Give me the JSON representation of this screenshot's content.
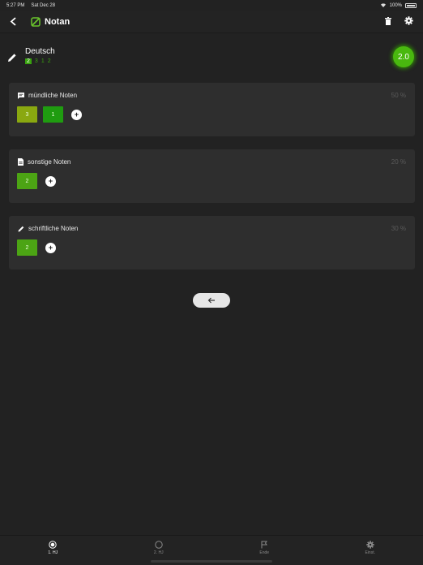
{
  "status_bar": {
    "time": "5:27 PM",
    "date": "Sat Dec 28",
    "battery": "100%"
  },
  "nav": {
    "title": "Notan"
  },
  "subject": {
    "name": "Deutsch",
    "grades": [
      "2",
      "3",
      "1",
      "2"
    ],
    "average": "2.0"
  },
  "cards": [
    {
      "title": "mündliche Noten",
      "percent": "50 %",
      "icon": "comment-icon",
      "grades": [
        "3",
        "1"
      ]
    },
    {
      "title": "sonstige Noten",
      "percent": "20 %",
      "icon": "document-icon",
      "grades": [
        "2"
      ]
    },
    {
      "title": "schriftliche Noten",
      "percent": "30 %",
      "icon": "pencil-icon",
      "grades": [
        "2"
      ]
    }
  ],
  "add_label": "+",
  "tabs": [
    {
      "label": "1. HJ",
      "icon": "radio-checked-icon",
      "active": true
    },
    {
      "label": "2. HJ",
      "icon": "radio-empty-icon",
      "active": false
    },
    {
      "label": "Ende",
      "icon": "flag-icon",
      "active": false
    },
    {
      "label": "Einst.",
      "icon": "gear-icon",
      "active": false
    }
  ],
  "colors": {
    "background": "#222222",
    "card": "#2e2e2e",
    "accent": "#39a30f",
    "badge": "#49b80f"
  }
}
